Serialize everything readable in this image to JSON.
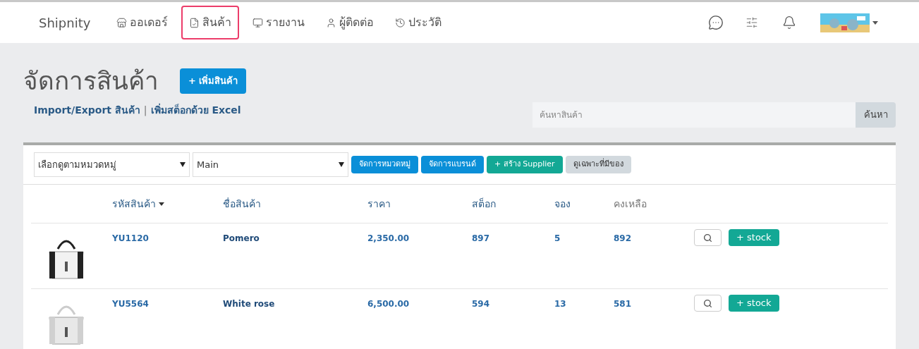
{
  "navbar": {
    "brand": "Shipnity",
    "items": [
      {
        "label": "ออเดอร์",
        "selected": false
      },
      {
        "label": "สินค้า",
        "selected": true
      },
      {
        "label": "รายงาน",
        "selected": false
      },
      {
        "label": "ผู้ติดต่อ",
        "selected": false
      },
      {
        "label": "ประวัติ",
        "selected": false
      }
    ]
  },
  "page": {
    "title": "จัดการสินค้า",
    "add_button": "+ เพิ่มสินค้า",
    "links": [
      "Import/Export สินค้า",
      "เพิ่มสต็อกด้วย Excel"
    ],
    "separator": "|"
  },
  "search": {
    "placeholder": "ค้นหาสินค้า",
    "button": "ค้นหา"
  },
  "filters": {
    "selects": [
      "เลือกดูตามหมวดหมู่",
      "Main"
    ],
    "buttons": [
      {
        "label": "จัดการหมวดหมู่",
        "kind": "primary"
      },
      {
        "label": "จัดการแบรนด์",
        "kind": "primary"
      },
      {
        "label": "+ สร้าง Supplier",
        "kind": "success"
      },
      {
        "label": "ดูเฉพาะที่มีของ",
        "kind": "muted"
      }
    ]
  },
  "table": {
    "columns": [
      {
        "label": "รหัสสินค้า",
        "sorted": true,
        "muted": false
      },
      {
        "label": "ชื่อสินค้า",
        "sorted": false,
        "muted": false
      },
      {
        "label": "ราคา",
        "sorted": false,
        "muted": false
      },
      {
        "label": "สต็อก",
        "sorted": false,
        "muted": false
      },
      {
        "label": "จอง",
        "sorted": false,
        "muted": false
      },
      {
        "label": "คงเหลือ",
        "sorted": false,
        "muted": true
      }
    ],
    "rows": [
      {
        "cells": [
          "YU1120",
          "Pomero",
          "2,350.00",
          "897",
          "5",
          "892"
        ],
        "stock_button": "+ stock"
      },
      {
        "cells": [
          "YU5564",
          "White rose",
          "6,500.00",
          "594",
          "13",
          "581"
        ],
        "stock_button": "+ stock"
      }
    ]
  }
}
